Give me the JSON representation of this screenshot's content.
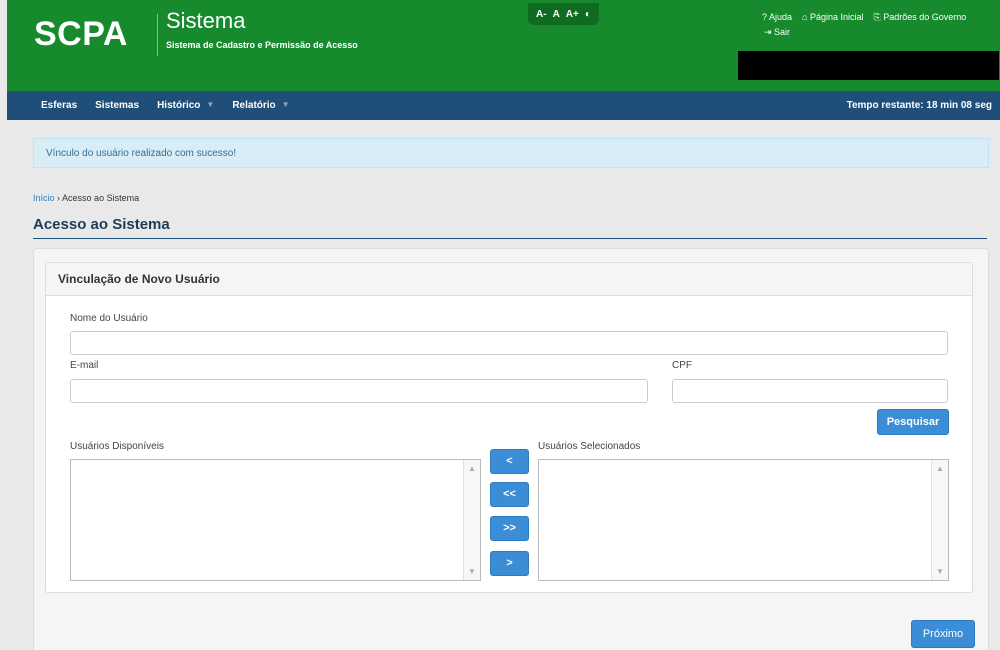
{
  "header": {
    "logo": "SCPA",
    "title": "Sistema",
    "subtitle": "Sistema de Cadastro e Permissão de Acesso",
    "font_controls": [
      "A-",
      "A",
      "A+",
      "◐"
    ],
    "links": {
      "help": "? Ajuda",
      "home": "⌂ Página Inicial",
      "gov": "⎘ Padrões do Governo",
      "logout": "⇥ Sair"
    }
  },
  "nav": {
    "items": [
      "Esferas",
      "Sistemas",
      "Histórico",
      "Relatório"
    ],
    "caret": "▼",
    "timer": "Tempo restante: 18 min 08 seg"
  },
  "alert": "Vínculo do usuário realizado com sucesso!",
  "breadcrumb": {
    "home": "Início",
    "sep": "›",
    "current": "Acesso ao Sistema"
  },
  "page_title": "Acesso ao Sistema",
  "form": {
    "panel_title": "Vinculação de Novo Usuário",
    "name_label": "Nome do Usuário",
    "name_value": "",
    "email_label": "E-mail",
    "email_value": "",
    "cpf_label": "CPF",
    "cpf_value": "",
    "search_button": "Pesquisar",
    "available_label": "Usuários Disponíveis",
    "selected_label": "Usuários Selecionados",
    "transfer_buttons": [
      "<",
      "<<",
      ">>",
      ">"
    ],
    "scroll_up": "▲",
    "scroll_down": "▼"
  },
  "next_button": "Próximo",
  "colors": {
    "header_green": "#178a2e",
    "navbar_blue": "#1f4e79",
    "button_blue": "#3b8ed5",
    "alert_bg": "#d9edf7"
  }
}
